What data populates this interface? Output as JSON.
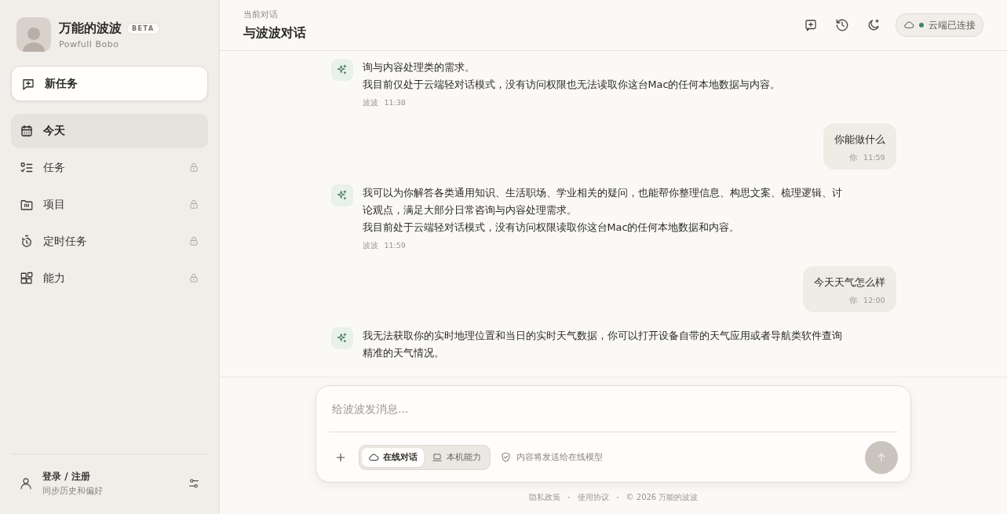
{
  "sidebar": {
    "app_name": "万能的波波",
    "badge": "BETA",
    "subtitle": "Powfull Bobo",
    "new_task_button": "新任务",
    "nav_items": [
      {
        "label": "今天",
        "kind": "calendar",
        "selected": true,
        "locked": false
      },
      {
        "label": "任务",
        "kind": "checklist",
        "selected": false,
        "locked": true
      },
      {
        "label": "项目",
        "kind": "folder",
        "selected": false,
        "locked": true
      },
      {
        "label": "定时任务",
        "kind": "timer",
        "selected": false,
        "locked": true
      },
      {
        "label": "能力",
        "kind": "blocks",
        "selected": false,
        "locked": true
      }
    ],
    "account": {
      "title": "登录 / 注册",
      "subtitle": "同步历史和偏好"
    }
  },
  "header": {
    "caption": "当前对话",
    "title": "与波波对话",
    "status": "云端已连接",
    "connected": true
  },
  "messages": [
    {
      "kind": "assistant",
      "paragraphs": [
        "询与内容处理类的需求。",
        "我目前仅处于云端轻对话模式，没有访问权限也无法读取你这台Mac的任何本地数据与内容。"
      ],
      "sender": "波波",
      "time": "11:38"
    },
    {
      "kind": "user",
      "paragraphs": [
        "你能做什么"
      ],
      "sender": "你",
      "time": "11:59"
    },
    {
      "kind": "assistant",
      "paragraphs": [
        "我可以为你解答各类通用知识、生活职场、学业相关的疑问，也能帮你整理信息、构思文案、梳理逻辑、讨论观点，满足大部分日常咨询与内容处理需求。",
        "我目前处于云端轻对话模式，没有访问权限读取你这台Mac的任何本地数据和内容。"
      ],
      "sender": "波波",
      "time": "11:59"
    },
    {
      "kind": "user",
      "paragraphs": [
        "今天天气怎么样"
      ],
      "sender": "你",
      "time": "12:00"
    },
    {
      "kind": "assistant",
      "paragraphs": [
        "我无法获取你的实时地理位置和当日的实时天气数据，你可以打开设备自带的天气应用或者导航类软件查询精准的天气情况。"
      ]
    }
  ],
  "composer": {
    "placeholder": "给波波发消息...",
    "modes": [
      {
        "label": "在线对话",
        "kind": "cloud",
        "selected": true
      },
      {
        "label": "本机能力",
        "kind": "laptop",
        "selected": false
      }
    ],
    "notice": "内容将发送给在线模型"
  },
  "footer": {
    "links": [
      "隐私政策",
      "使用协议"
    ],
    "copyright": "© 2026 万能的波波"
  }
}
